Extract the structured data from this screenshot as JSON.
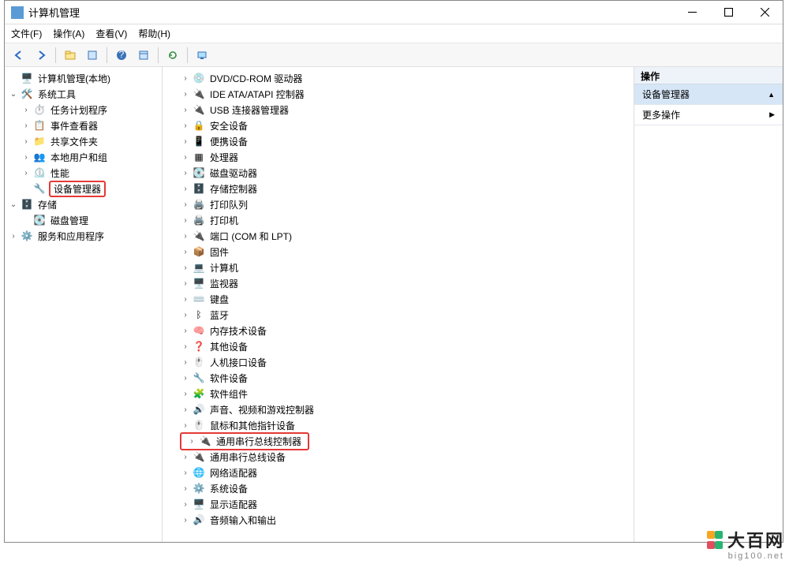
{
  "window": {
    "title": "计算机管理"
  },
  "menu": {
    "file": "文件(F)",
    "action": "操作(A)",
    "view": "查看(V)",
    "help": "帮助(H)"
  },
  "left": {
    "root": "计算机管理(本地)",
    "sys_tools": "系统工具",
    "sys_children": [
      "任务计划程序",
      "事件查看器",
      "共享文件夹",
      "本地用户和组",
      "性能",
      "设备管理器"
    ],
    "storage": "存储",
    "storage_children": [
      "磁盘管理"
    ],
    "services": "服务和应用程序"
  },
  "mid": [
    "DVD/CD-ROM 驱动器",
    "IDE ATA/ATAPI 控制器",
    "USB 连接器管理器",
    "安全设备",
    "便携设备",
    "处理器",
    "磁盘驱动器",
    "存储控制器",
    "打印队列",
    "打印机",
    "端口 (COM 和 LPT)",
    "固件",
    "计算机",
    "监视器",
    "键盘",
    "蓝牙",
    "内存技术设备",
    "其他设备",
    "人机接口设备",
    "软件设备",
    "软件组件",
    "声音、视频和游戏控制器",
    "鼠标和其他指针设备",
    "通用串行总线控制器",
    "通用串行总线设备",
    "网络适配器",
    "系统设备",
    "显示适配器",
    "音频输入和输出"
  ],
  "mid_highlight_index": 23,
  "right": {
    "header": "操作",
    "sel": "设备管理器",
    "more": "更多操作"
  },
  "watermark": {
    "brand": "大百网",
    "domain": "big100.net"
  }
}
